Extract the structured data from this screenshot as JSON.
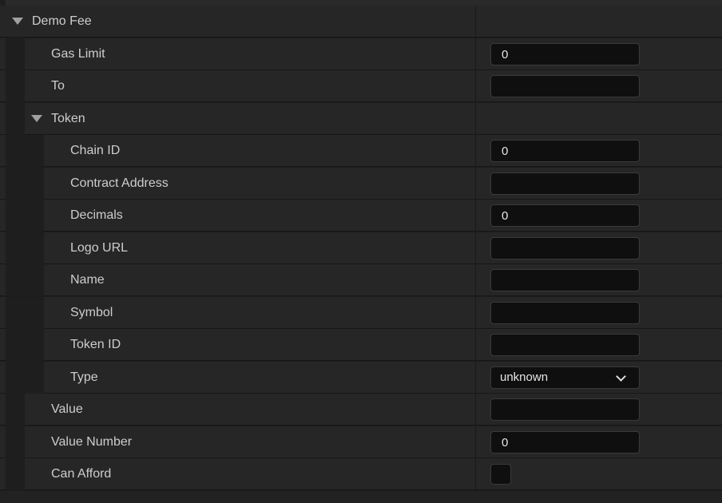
{
  "section": {
    "title": "Demo Fee",
    "expanded": true
  },
  "fields": {
    "gas_limit": {
      "label": "Gas Limit",
      "value": "0"
    },
    "to": {
      "label": "To",
      "value": ""
    },
    "token": {
      "label": "Token",
      "expanded": true,
      "chain_id": {
        "label": "Chain ID",
        "value": "0"
      },
      "contract_address": {
        "label": "Contract Address",
        "value": ""
      },
      "decimals": {
        "label": "Decimals",
        "value": "0"
      },
      "logo_url": {
        "label": "Logo URL",
        "value": ""
      },
      "name": {
        "label": "Name",
        "value": ""
      },
      "symbol": {
        "label": "Symbol",
        "value": ""
      },
      "token_id": {
        "label": "Token ID",
        "value": ""
      },
      "type": {
        "label": "Type",
        "selected": "unknown"
      }
    },
    "value": {
      "label": "Value",
      "value": ""
    },
    "value_number": {
      "label": "Value Number",
      "value": "0"
    },
    "can_afford": {
      "label": "Can Afford",
      "checked": false
    }
  },
  "icons": {
    "expand": "caret-down-icon",
    "dropdown": "chevron-down-icon"
  }
}
